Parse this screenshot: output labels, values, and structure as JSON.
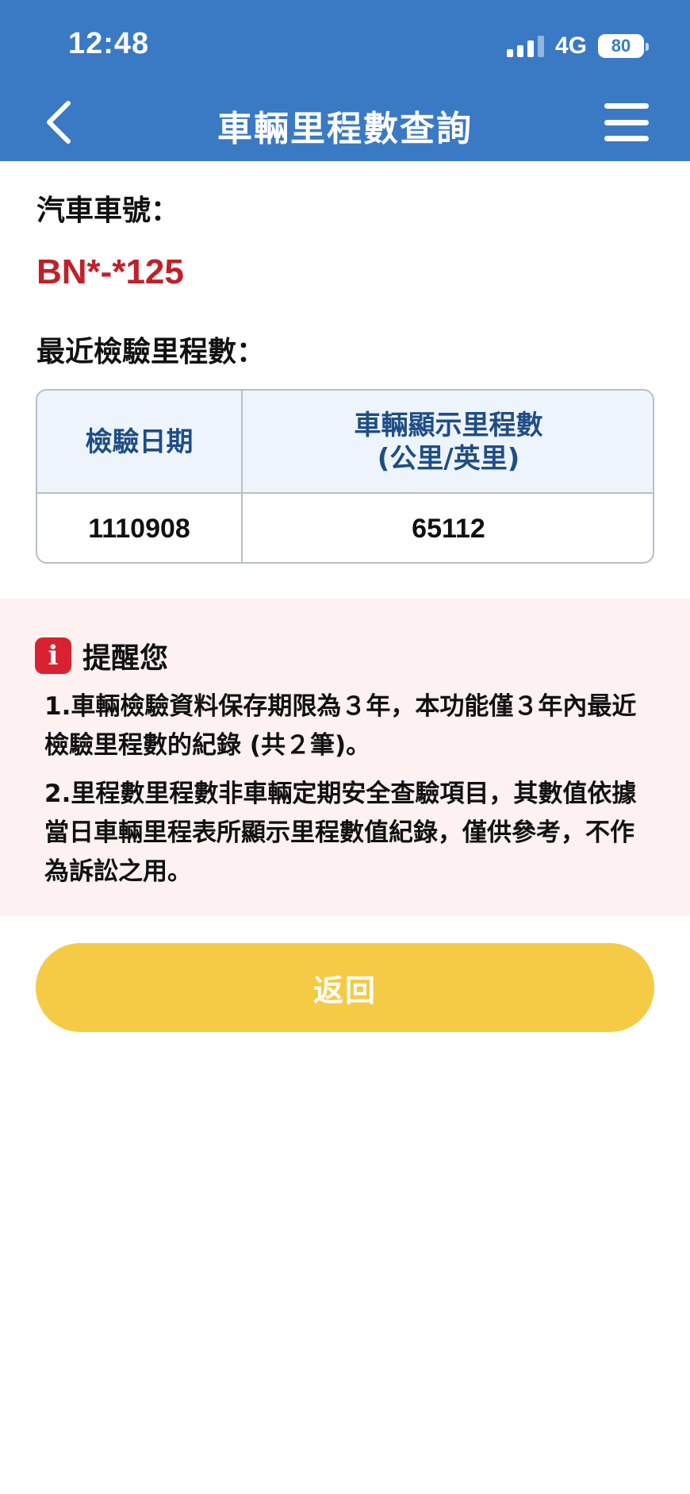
{
  "status_bar": {
    "time": "12:48",
    "network": "4G",
    "battery": "80"
  },
  "header": {
    "title": "車輛里程數查詢",
    "back_icon": "chevron-left-icon",
    "menu_icon": "hamburger-menu-icon"
  },
  "vehicle": {
    "plate_label": "汽車車號：",
    "plate_number": "BN*-*125"
  },
  "mileage": {
    "section_label": "最近檢驗里程數：",
    "columns": [
      "檢驗日期",
      "車輛顯示里程數",
      "(公里/英里)"
    ],
    "rows": [
      {
        "date": "1110908",
        "mileage": "65112"
      }
    ]
  },
  "notice": {
    "icon": "info-icon",
    "icon_glyph": "i",
    "title": "提醒您",
    "items": [
      "1.車輛檢驗資料保存期限為３年，本功能僅３年內最近檢驗里程數的紀錄 (共２筆)。",
      "2.里程數里程數非車輛定期安全查驗項目，其數值依據當日車輛里程表所顯示里程數值紀錄，僅供參考，不作為訴訟之用。"
    ]
  },
  "actions": {
    "return_label": "返回"
  },
  "colors": {
    "header_bg": "#3a79c4",
    "plate_red": "#c0202a",
    "table_header_text": "#1f4d86",
    "notice_bg": "#fdf1f2",
    "info_red": "#d92231",
    "button_yellow": "#f5cb45"
  }
}
